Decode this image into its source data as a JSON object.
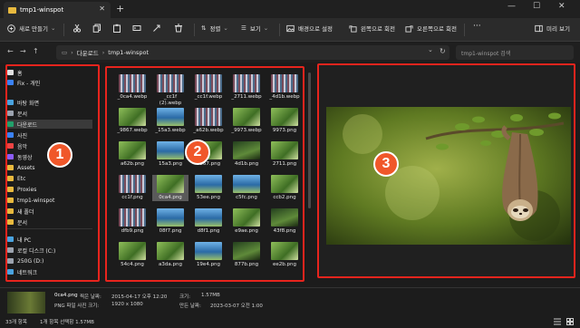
{
  "window": {
    "tab_title": "tmp1-winspot",
    "close_glyph": "✕",
    "newtab_glyph": "+",
    "controls": [
      "—",
      "☐",
      "✕"
    ]
  },
  "commandbar": {
    "new_label": "새로 만들기",
    "sort_label": "정렬",
    "view_label": "보기",
    "set_background_label": "배경으로 설정",
    "rotate_left_label": "왼쪽으로 회전",
    "rotate_right_label": "오른쪽으로 회전",
    "more_glyph": "···",
    "preview_label": "미리 보기"
  },
  "address": {
    "back": "←",
    "forward": "→",
    "up": "↑",
    "refresh": "↻",
    "crumb_home": "▭",
    "crumb_1": "다운로드",
    "crumb_2": "tmp1-winspot",
    "chevron": "›",
    "dropdown": "⌄",
    "search_placeholder": "tmp1-winspot 검색"
  },
  "navpane": {
    "items": [
      {
        "label": "홈",
        "color": "#e0e0e0"
      },
      {
        "label": "Fix - 개인",
        "color": "#3b82f6"
      },
      {
        "label": "바탕 화면",
        "color": "#4aa3df"
      },
      {
        "label": "문서",
        "color": "#9ca3af"
      },
      {
        "label": "다운로드",
        "color": "#22a06b"
      },
      {
        "label": "사진",
        "color": "#3b82f6"
      },
      {
        "label": "음악",
        "color": "#ef4444"
      },
      {
        "label": "동영상",
        "color": "#8b5cf6"
      },
      {
        "label": "Assets",
        "color": "#e8b93e"
      },
      {
        "label": "Etc",
        "color": "#e8b93e"
      },
      {
        "label": "Proxies",
        "color": "#e8b93e"
      },
      {
        "label": "tmp1-winspot",
        "color": "#e8b93e"
      },
      {
        "label": "새 폴더",
        "color": "#e8b93e"
      },
      {
        "label": "문서",
        "color": "#e8b93e"
      },
      {
        "label": "내 PC",
        "color": "#4aa3df"
      },
      {
        "label": "로컬 디스크 (C:)",
        "color": "#9ca3af"
      },
      {
        "label": "250G (D:)",
        "color": "#9ca3af"
      },
      {
        "label": "네트워크",
        "color": "#4aa3df"
      }
    ]
  },
  "files": [
    {
      "name": "_0ca4.webp",
      "thumb": "stripes"
    },
    {
      "name": "_cc1f (2).webp",
      "thumb": "stripes"
    },
    {
      "name": "_cc1f.webp",
      "thumb": "stripes"
    },
    {
      "name": "_2711.webp",
      "thumb": "stripes"
    },
    {
      "name": "_4d1b.webp",
      "thumb": "stripes"
    },
    {
      "name": "_9867.webp",
      "thumb": "green"
    },
    {
      "name": "_15a3.webp",
      "thumb": "blue"
    },
    {
      "name": "_a62b.webp",
      "thumb": "stripes"
    },
    {
      "name": "_9973.webp",
      "thumb": "green"
    },
    {
      "name": "9973.png",
      "thumb": "green"
    },
    {
      "name": "a62b.png",
      "thumb": "green"
    },
    {
      "name": "15a3.png",
      "thumb": "blue"
    },
    {
      "name": "9867.png",
      "thumb": "green"
    },
    {
      "name": "4d1b.png",
      "thumb": "forest"
    },
    {
      "name": "2711.png",
      "thumb": "green"
    },
    {
      "name": "cc1f.png",
      "thumb": "stripes"
    },
    {
      "name": "0ca4.png",
      "thumb": "green"
    },
    {
      "name": "53ee.png",
      "thumb": "blue"
    },
    {
      "name": "c5fc.png",
      "thumb": "blue"
    },
    {
      "name": "ccb2.png",
      "thumb": "green"
    },
    {
      "name": "dfb9.png",
      "thumb": "stripes"
    },
    {
      "name": "08f7.png",
      "thumb": "blue"
    },
    {
      "name": "d8f1.png",
      "thumb": "blue"
    },
    {
      "name": "e9ae.png",
      "thumb": "green"
    },
    {
      "name": "43f8.png",
      "thumb": "forest"
    },
    {
      "name": "54c4.png",
      "thumb": "green"
    },
    {
      "name": "a3da.png",
      "thumb": "green"
    },
    {
      "name": "19e4.png",
      "thumb": "blue"
    },
    {
      "name": "877b.png",
      "thumb": "forest"
    },
    {
      "name": "ee2b.png",
      "thumb": "green"
    }
  ],
  "annotations": {
    "one": "1",
    "two": "2",
    "three": "3"
  },
  "details": {
    "filename": "0ca4.png",
    "taken_label": "찍은 날짜:",
    "taken_value": "2015-04-17 오후 12:20",
    "size_label": "크기:",
    "size_value": "1.57MB",
    "type": "PNG 파일 사진 크기:",
    "dimensions": "1920 x 1080",
    "created_label": "만든 날짜:",
    "created_value": "2023-03-07 오전 1:00"
  },
  "status": {
    "count": "33개 항목",
    "selection": "1개 항목 선택함 1.57MB"
  },
  "colors": {
    "annotation_red": "#e8241d",
    "badge_orange": "#f0572a"
  }
}
